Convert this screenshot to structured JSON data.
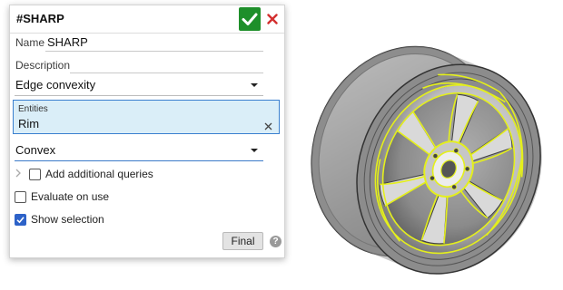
{
  "feature_dialog": {
    "title": "#SHARP",
    "name_label": "Name",
    "name_value": "SHARP",
    "description_label": "Description",
    "description_value": "",
    "query_type": "Edge convexity",
    "entities_label": "Entities",
    "entities": [
      "Rim"
    ],
    "convexity": "Convex",
    "add_queries_label": "Add additional queries",
    "add_queries_checked": false,
    "evaluate_label": "Evaluate on use",
    "evaluate_checked": false,
    "show_selection_label": "Show selection",
    "show_selection_checked": true,
    "final_button": "Final",
    "help_glyph": "?"
  },
  "icons": {
    "ok": "checkmark-icon",
    "cancel": "close-icon",
    "remove_entity": "close-icon",
    "expand": "chevron-right-icon",
    "help": "help-icon"
  },
  "colors": {
    "accept": "#1e8f2a",
    "cancel": "#d32f2f",
    "selection_bg": "#daeef8",
    "selection_border": "#3a7fcf",
    "highlight": "#e4ef1c"
  },
  "viewport": {
    "model": "wheel rim",
    "highlighted_edges": "convex edges"
  }
}
